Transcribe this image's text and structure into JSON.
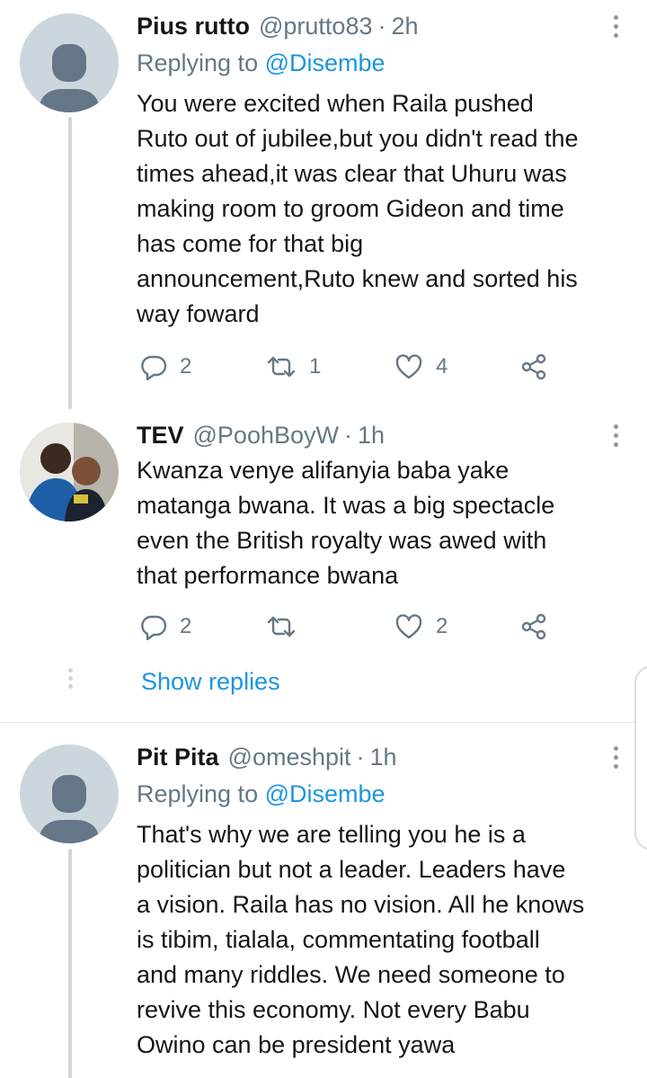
{
  "tweets": [
    {
      "name": "Pius rutto",
      "handle": "@prutto83",
      "separator": "·",
      "time": "2h",
      "replying_prefix": "Replying to",
      "replying_to": "@Disembe",
      "text": "You were excited when Raila pushed\nRuto out of jubilee,but you didn't read the\ntimes ahead,it was clear that Uhuru was\nmaking room to groom Gideon and time\nhas come for that big\nannouncement,Ruto knew and sorted his\nway foward",
      "replies": "2",
      "retweets": "1",
      "likes": "4"
    },
    {
      "name": "TEV",
      "handle": "@PoohBoyW",
      "separator": "·",
      "time": "1h",
      "text": "Kwanza venye alifanyia baba yake\nmatanga bwana. It was a big spectacle\neven the British royalty was awed with\nthat performance bwana",
      "replies": "2",
      "retweets": "",
      "likes": "2"
    },
    {
      "name": "Pit Pita",
      "handle": "@omeshpit",
      "separator": "·",
      "time": "1h",
      "replying_prefix": "Replying to",
      "replying_to": "@Disembe",
      "text": "That's why we are telling you he is a\npolitician but not a leader. Leaders have\na vision. Raila has no vision. All he knows\nis tibim, tialala, commentating football\nand many riddles. We need someone to\nrevive this economy. Not every Babu\nOwino can be president yawa"
    }
  ],
  "show_replies_label": "Show replies",
  "icons": [
    "more-vertical-icon",
    "reply-icon",
    "retweet-icon",
    "like-icon",
    "share-icon",
    "default-avatar-icon"
  ],
  "colors": {
    "link": "#1b95e0",
    "secondary_text": "#657786",
    "thread_line": "#ccd6dd",
    "primary_text": "#14171a"
  }
}
